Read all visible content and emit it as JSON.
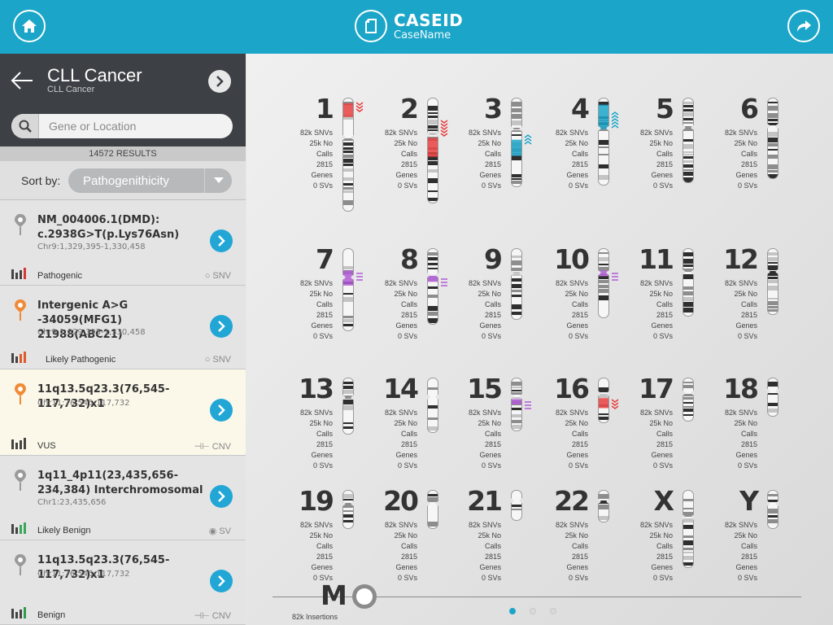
{
  "header": {
    "case_id": "CASEID",
    "case_name": "CaseName"
  },
  "sidebar": {
    "title": "CLL Cancer",
    "subtitle": "CLL Cancer",
    "search_placeholder": "Gene or Location",
    "results": "14572 RESULTS",
    "sort_label": "Sort by:",
    "sort_value": "Pathogenithicity"
  },
  "variants": [
    {
      "title": "NM_004006.1(DMD): c.2938G>T(p.Lys76Asn)",
      "location": "Chr9:1,329,395-1,330,458",
      "classification": "Pathogenic",
      "type": "SNV",
      "pin_color": "#9a9a9a",
      "bar_color": "#d9363a",
      "level": 4
    },
    {
      "title": "Intergenic A>G -34059(MFG1) 21988(ABC21)",
      "location": "Chr9:1,329,395-1,330,458",
      "classification": "Likely Pathogenic",
      "type": "SNV",
      "pin_color": "#f08a35",
      "bar_color": "#e05a2a",
      "level": 3
    },
    {
      "title": "11q13.5q23.3(76,545-117,732)x1",
      "location": "Chr11:76,545-117,732",
      "classification": "VUS",
      "type": "CNV",
      "pin_color": "#f08a35",
      "bar_color": "#444444",
      "level": 4
    },
    {
      "title": "1q11_4p11(23,435,656-234,384) Interchromosomal",
      "location": "Chr1:23,435,656",
      "classification": "Likely Benign",
      "type": "SV",
      "pin_color": "#9a9a9a",
      "bar_color": "#3ba55a",
      "level": 3
    },
    {
      "title": "11q13.5q23.3(76,545-117,732)x1",
      "location": "Chr11:76,545-117,732",
      "classification": "Benign",
      "type": "CNV",
      "pin_color": "#9a9a9a",
      "bar_color": "#2e9b4e",
      "level": 4
    }
  ],
  "chromosomes": [
    {
      "label": "1",
      "snvs": "82k SNVs",
      "no_calls": "25k No Calls",
      "genes": "2815 Genes",
      "svs": "0 SVs"
    },
    {
      "label": "2",
      "snvs": "82k SNVs",
      "no_calls": "25k No Calls",
      "genes": "2815 Genes",
      "svs": "0 SVs"
    },
    {
      "label": "3",
      "snvs": "82k SNVs",
      "no_calls": "25k No Calls",
      "genes": "2815 Genes",
      "svs": "0 SVs"
    },
    {
      "label": "4",
      "snvs": "82k SNVs",
      "no_calls": "25k No Calls",
      "genes": "2815 Genes",
      "svs": "0 SVs"
    },
    {
      "label": "5",
      "snvs": "82k SNVs",
      "no_calls": "25k No Calls",
      "genes": "2815 Genes",
      "svs": "0 SVs"
    },
    {
      "label": "6",
      "snvs": "82k SNVs",
      "no_calls": "25k No Calls",
      "genes": "2815 Genes",
      "svs": "0 SVs"
    },
    {
      "label": "7",
      "snvs": "82k SNVs",
      "no_calls": "25k No Calls",
      "genes": "2815 Genes",
      "svs": "0 SVs"
    },
    {
      "label": "8",
      "snvs": "82k SNVs",
      "no_calls": "25k No Calls",
      "genes": "2815 Genes",
      "svs": "0 SVs"
    },
    {
      "label": "9",
      "snvs": "82k SNVs",
      "no_calls": "25k No Calls",
      "genes": "2815 Genes",
      "svs": "0 SVs"
    },
    {
      "label": "10",
      "snvs": "82k SNVs",
      "no_calls": "25k No Calls",
      "genes": "2815 Genes",
      "svs": "0 SVs"
    },
    {
      "label": "11",
      "snvs": "82k SNVs",
      "no_calls": "25k No Calls",
      "genes": "2815 Genes",
      "svs": "0 SVs"
    },
    {
      "label": "12",
      "snvs": "82k SNVs",
      "no_calls": "25k No Calls",
      "genes": "2815 Genes",
      "svs": "0 SVs"
    },
    {
      "label": "13",
      "snvs": "82k SNVs",
      "no_calls": "25k No Calls",
      "genes": "2815 Genes",
      "svs": "0 SVs"
    },
    {
      "label": "14",
      "snvs": "82k SNVs",
      "no_calls": "25k No Calls",
      "genes": "2815 Genes",
      "svs": "0 SVs"
    },
    {
      "label": "15",
      "snvs": "82k SNVs",
      "no_calls": "25k No Calls",
      "genes": "2815 Genes",
      "svs": "0 SVs"
    },
    {
      "label": "16",
      "snvs": "82k SNVs",
      "no_calls": "25k No Calls",
      "genes": "2815 Genes",
      "svs": "0 SVs"
    },
    {
      "label": "17",
      "snvs": "82k SNVs",
      "no_calls": "25k No Calls",
      "genes": "2815 Genes",
      "svs": "0 SVs"
    },
    {
      "label": "18",
      "snvs": "82k SNVs",
      "no_calls": "25k No Calls",
      "genes": "2815 Genes",
      "svs": "0 SVs"
    },
    {
      "label": "19",
      "snvs": "82k SNVs",
      "no_calls": "25k No Calls",
      "genes": "2815 Genes",
      "svs": "0 SVs"
    },
    {
      "label": "20",
      "snvs": "82k SNVs",
      "no_calls": "25k No Calls",
      "genes": "2815 Genes",
      "svs": "0 SVs"
    },
    {
      "label": "21",
      "snvs": "82k SNVs",
      "no_calls": "25k No Calls",
      "genes": "2815 Genes",
      "svs": "0 SVs"
    },
    {
      "label": "22",
      "snvs": "82k SNVs",
      "no_calls": "25k No Calls",
      "genes": "2815 Genes",
      "svs": "0 SVs"
    },
    {
      "label": "X",
      "snvs": "82k SNVs",
      "no_calls": "25k No Calls",
      "genes": "2815 Genes",
      "svs": "0 SVs"
    },
    {
      "label": "Y",
      "snvs": "82k SNVs",
      "no_calls": "25k No Calls",
      "genes": "2815 Genes",
      "svs": "0 SVs"
    }
  ],
  "mito": {
    "label": "M",
    "insertions": "82k Insertions"
  },
  "pager": {
    "pages": 3,
    "active": 1
  },
  "colors": {
    "accent": "#1ba6c9",
    "dark": "#3d4145",
    "button": "#21a6d6",
    "highlight_red": "#e84040",
    "highlight_cyan": "#1ba6c9",
    "highlight_purple": "#b15bd6"
  }
}
